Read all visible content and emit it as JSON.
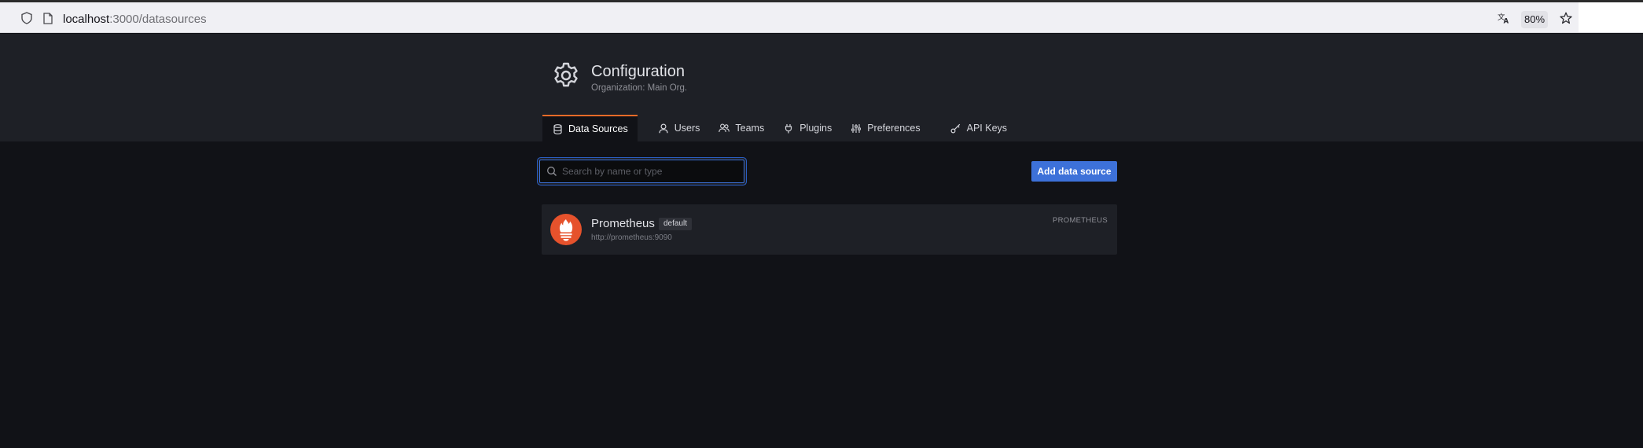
{
  "browser": {
    "url_host": "localhost",
    "url_path": ":3000/datasources",
    "zoom": "80%",
    "icons": [
      "shield-icon",
      "page-icon",
      "translate-icon",
      "star-icon"
    ]
  },
  "header": {
    "icon": "gear-icon",
    "title": "Configuration",
    "subtitle": "Organization: Main Org."
  },
  "tabs": [
    {
      "label": "Data Sources",
      "icon": "database-icon",
      "active": true
    },
    {
      "label": "Users",
      "icon": "user-icon",
      "active": false
    },
    {
      "label": "Teams",
      "icon": "users-icon",
      "active": false
    },
    {
      "label": "Plugins",
      "icon": "plug-icon",
      "active": false
    },
    {
      "label": "Preferences",
      "icon": "sliders-icon",
      "active": false
    },
    {
      "label": "API Keys",
      "icon": "key-icon",
      "active": false
    }
  ],
  "search": {
    "placeholder": "Search by name or type",
    "value": ""
  },
  "actions": {
    "add_label": "Add data source"
  },
  "datasources": [
    {
      "name": "Prometheus",
      "badge": "default",
      "url": "http://prometheus:9090",
      "type": "PROMETHEUS",
      "icon": "prometheus-logo"
    }
  ],
  "colors": {
    "accent": "#3d71d9",
    "tab_active": "#f36b28",
    "prometheus": "#e6522c",
    "bg": "#111217",
    "panel": "#1e2026"
  }
}
